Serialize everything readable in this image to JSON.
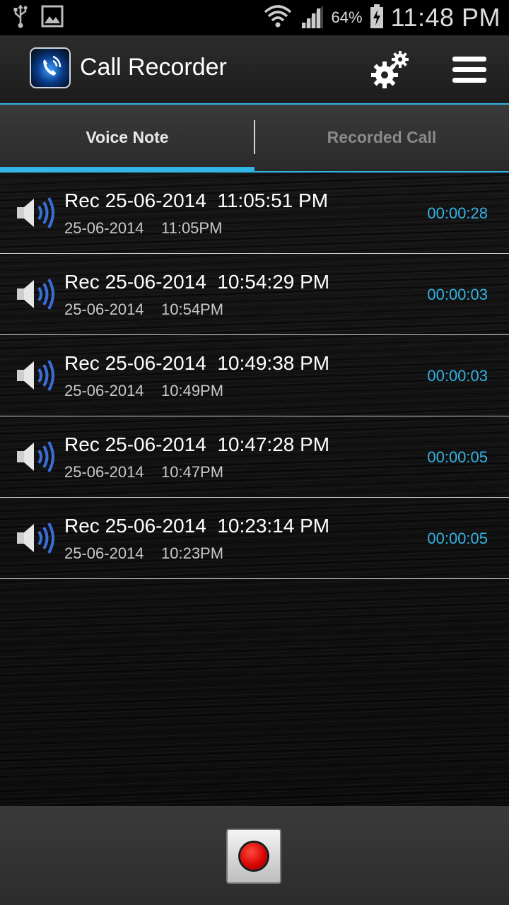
{
  "status_bar": {
    "battery_percent": "64%",
    "time": "11:48 PM",
    "icons": [
      "usb-icon",
      "image-icon",
      "wifi-icon",
      "signal-icon",
      "battery-charging-icon"
    ]
  },
  "app_bar": {
    "title": "Call Recorder",
    "icons": [
      "app-logo-icon",
      "settings-gears-icon",
      "menu-icon"
    ]
  },
  "tabs": [
    {
      "label": "Voice Note",
      "selected": true
    },
    {
      "label": "Recorded Call",
      "selected": false
    }
  ],
  "recordings": [
    {
      "title": "Rec 25-06-2014  11:05:51 PM",
      "date": "25-06-2014",
      "time": "11:05PM",
      "duration": "00:00:28"
    },
    {
      "title": "Rec 25-06-2014  10:54:29 PM",
      "date": "25-06-2014",
      "time": "10:54PM",
      "duration": "00:00:03"
    },
    {
      "title": "Rec 25-06-2014  10:49:38 PM",
      "date": "25-06-2014",
      "time": "10:49PM",
      "duration": "00:00:03"
    },
    {
      "title": "Rec 25-06-2014  10:47:28 PM",
      "date": "25-06-2014",
      "time": "10:47PM",
      "duration": "00:00:05"
    },
    {
      "title": "Rec 25-06-2014  10:23:14 PM",
      "date": "25-06-2014",
      "time": "10:23PM",
      "duration": "00:00:05"
    }
  ],
  "bottom_bar": {
    "record_button_icon": "record-icon"
  },
  "colors": {
    "accent": "#33b5e5",
    "record_red": "#e00000"
  }
}
